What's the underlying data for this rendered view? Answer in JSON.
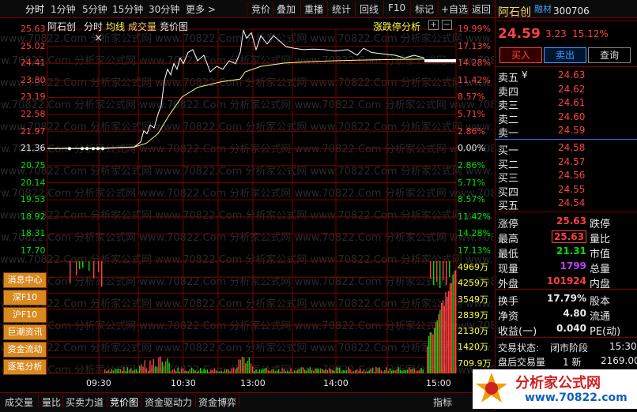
{
  "toolbar": {
    "tabs": [
      "分时",
      "1分钟",
      "5分钟",
      "15分钟",
      "30分钟",
      "更多 >"
    ],
    "right_tabs": [
      "竞价",
      "叠加",
      "重播",
      "统计",
      "回线",
      "F10",
      "标记",
      "+自选",
      "返回"
    ]
  },
  "chart_header": {
    "stock_name": "阿石创",
    "label_fenshi": "分时",
    "label_junxian": "均线",
    "label_chengjiaoliang": "成交量",
    "label_jingjiatu": "竞价图",
    "zhangdie_analysis": "涨跌停分析",
    "close_mark": "×"
  },
  "price_axis": {
    "left": [
      "25.63",
      "25.02",
      "24.41",
      "23.80",
      "23.19",
      "22.58",
      "21.97",
      "21.36",
      "20.75",
      "20.14",
      "19.53",
      "18.92",
      "18.31",
      "17.70"
    ],
    "right": [
      "19.99%",
      "17.13%",
      "14.28%",
      "11.42%",
      "8.57%",
      "5.71%",
      "2.86%",
      "0.00%",
      "2.86%",
      "5.71%",
      "8.57%",
      "11.42%",
      "14.28%",
      "17.13%"
    ]
  },
  "volume_axis": [
    "4969万",
    "4259万",
    "3549万",
    "2839万",
    "2130万",
    "1420万",
    "709.9万"
  ],
  "time_axis": [
    "09:30",
    "10:30",
    "13:00",
    "14:00",
    "15:00"
  ],
  "side_buttons": [
    "消息中心",
    "深F10",
    "沪F10",
    "巨潮资讯",
    "资金流动",
    "逐笔分析"
  ],
  "bottom_tabs": [
    "成交量",
    "量比",
    "买卖力道",
    "竞价图",
    "资金驱动力",
    "资金博弈"
  ],
  "bottom_right": "指标",
  "watermark": "www.70822.Com 分析家公式网",
  "quote": {
    "name": "阿石创",
    "tag": "融材",
    "code": "300706",
    "price": "24.59",
    "change": "3.23",
    "change_pct": "15.12%",
    "buy_btn": "买入",
    "sell_btn": "卖出",
    "query_btn": "查询",
    "sell_levels": [
      {
        "label": "卖五",
        "price": "24.63"
      },
      {
        "label": "卖四",
        "price": "24.62"
      },
      {
        "label": "卖三",
        "price": "24.61"
      },
      {
        "label": "卖二",
        "price": "24.60"
      },
      {
        "label": "卖一",
        "price": "24.59"
      }
    ],
    "sell_currency": "¥",
    "buy_levels": [
      {
        "label": "买一",
        "price": "24.58"
      },
      {
        "label": "买二",
        "price": "24.57"
      },
      {
        "label": "买三",
        "price": "24.56"
      },
      {
        "label": "买四",
        "price": "24.55"
      },
      {
        "label": "买五",
        "price": "24.54"
      }
    ],
    "stats": [
      {
        "label": "涨停",
        "value": "25.63",
        "label2": "跌停"
      },
      {
        "label": "最高",
        "value": "25.63",
        "label2": "量比"
      },
      {
        "label": "最低",
        "value": "21.31",
        "label2": "市值"
      },
      {
        "label": "现量",
        "value": "1799",
        "label2": "总量"
      },
      {
        "label": "外盘",
        "value": "101924",
        "label2": "内盘"
      }
    ],
    "stats2": [
      {
        "label": "换手",
        "value": "17.79%",
        "label2": "股本"
      },
      {
        "label": "净资",
        "value": "4.80",
        "label2": "流通"
      },
      {
        "label": "收益(一)",
        "value": "0.040",
        "label2": "PE(动)"
      }
    ],
    "trade_status_label": "交易状态:",
    "trade_status": "闭市阶段",
    "trade_time": "15:30",
    "after_label": "盘后交易量",
    "after_value": "1 新",
    "after_value2": "2169.00"
  },
  "logo": {
    "text": "分析家公式网",
    "url": "www.70822.com"
  },
  "colors": {
    "up": "#ff4040",
    "down": "#00e000",
    "avg_line": "#ffff80",
    "price_line": "#ffffff",
    "grid": "#7a0000",
    "side_button": "#d88a20"
  }
}
